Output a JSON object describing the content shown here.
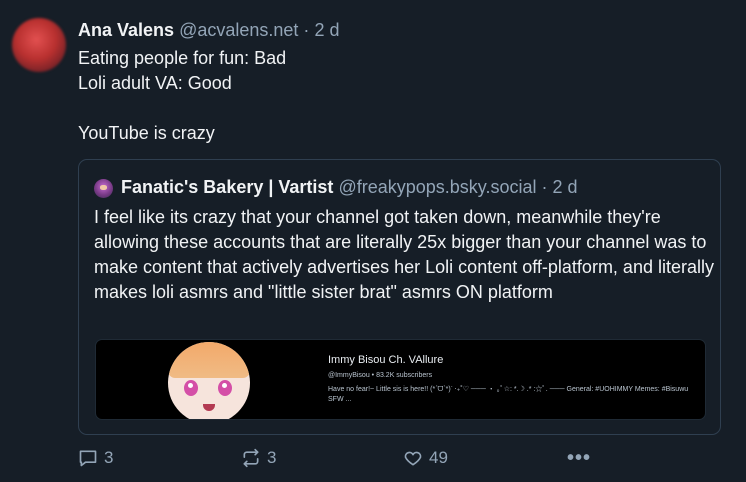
{
  "post": {
    "author_name": "Ana Valens",
    "author_handle": "@acvalens.net",
    "separator": "·",
    "time": "2 d",
    "text_lines": [
      "Eating people for fun: Bad",
      "Loli adult VA: Good",
      "",
      "YouTube is crazy"
    ]
  },
  "quote": {
    "author_name": "Fanatic's Bakery | Vartist",
    "author_handle": "@freakypops.bsky.social",
    "separator": "·",
    "time": "2 d",
    "text": "I feel like its crazy that your channel got taken down, meanwhile they're allowing these accounts that are literally 25x bigger than your channel was to make content that actively advertises her Loli content off-platform, and literally makes loli asmrs and \"little sister brat\" asmrs ON platform",
    "embed": {
      "channel_name": "Immy Bisou Ch. VAllure",
      "subscribers": "@ImmyBisou • 83.2K subscribers",
      "description": "Have no fear!~ Little sis is here!! (*ˊᗜˋ*)ᐝ ‧₊˚♡ ─── ・ ｡ﾟ☆: *.☽ .* :☆ﾟ. ─── General: #UOHIMMY Memes: #Bisuwu SFW ..."
    }
  },
  "actions": {
    "reply_count": "3",
    "repost_count": "3",
    "like_count": "49",
    "more_label": "•••"
  },
  "icons": {
    "reply": "reply-icon",
    "repost": "repost-icon",
    "like": "heart-icon",
    "more": "more-icon"
  },
  "colors": {
    "background": "#161e27",
    "muted": "#93a5b7",
    "text": "#f1f3f5",
    "border": "#2f3f50"
  }
}
